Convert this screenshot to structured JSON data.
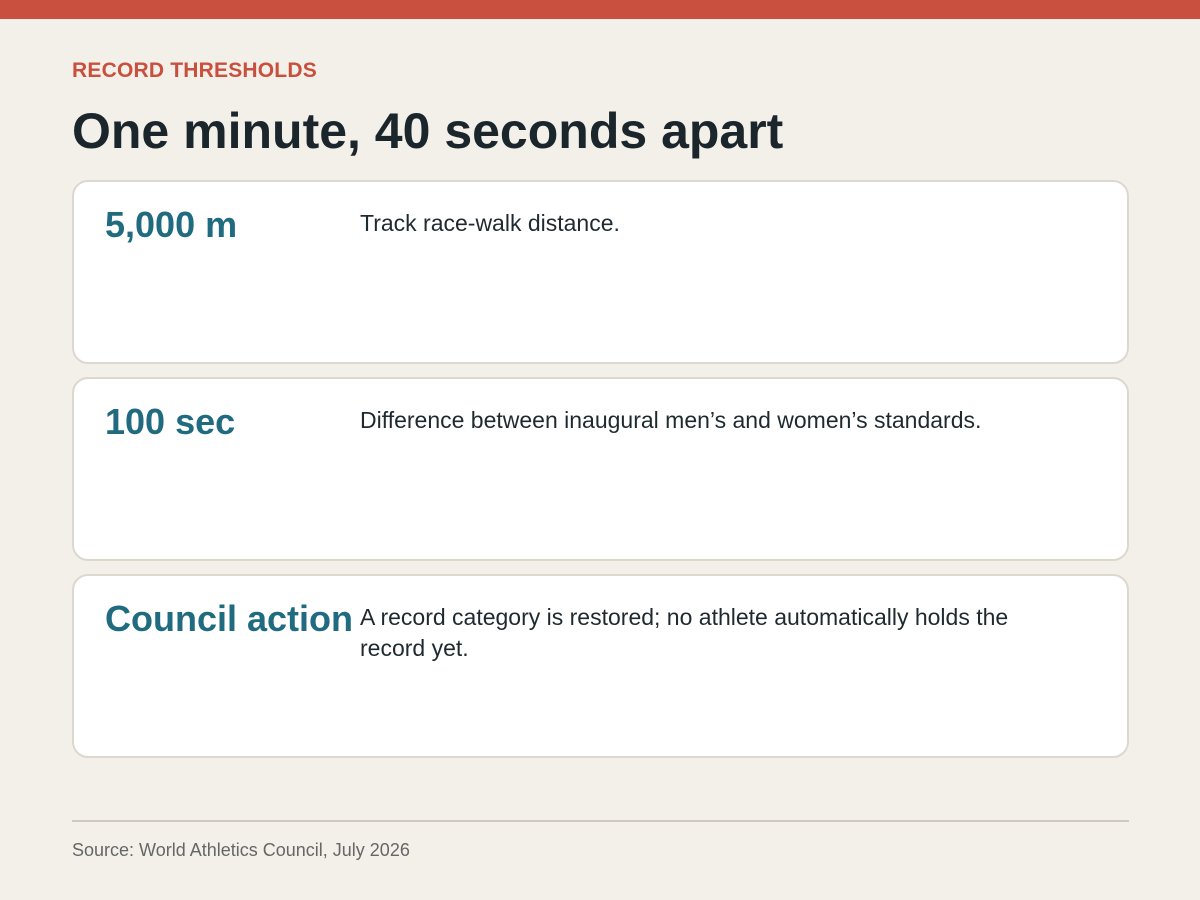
{
  "colors": {
    "accent": "#c9503e",
    "value_text": "#206b80",
    "headline_text": "#1b262c",
    "body_text": "#1f2a30",
    "source_text": "#666666"
  },
  "header": {
    "kicker": "RECORD THRESHOLDS",
    "title": "One minute, 40 seconds apart"
  },
  "cards": [
    {
      "value": "5,000 m",
      "description": "Track race-walk distance."
    },
    {
      "value": "100 sec",
      "description": "Difference between inaugural men’s and women’s standards."
    },
    {
      "value": "Council action",
      "description": "A record category is restored; no athlete automatically holds the record yet."
    }
  ],
  "footer": {
    "source": "Source: World Athletics Council, July 2026"
  }
}
